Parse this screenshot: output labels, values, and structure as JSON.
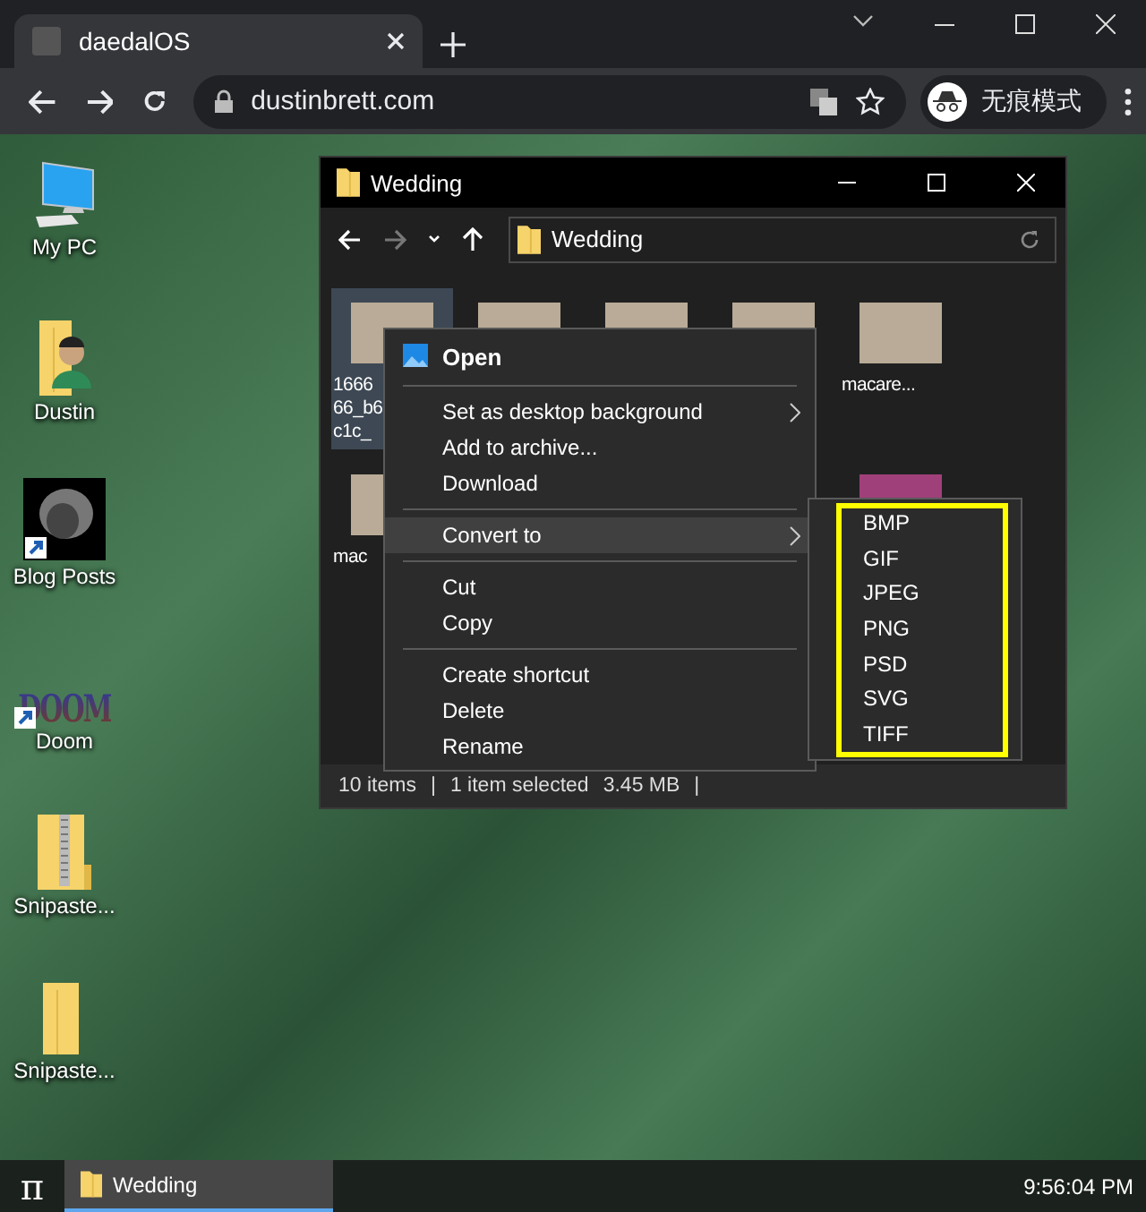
{
  "browser": {
    "tabs": [
      {
        "title": "daedalOS",
        "selected": true
      }
    ],
    "address": "dustinbrett.com",
    "profile": "无痕模式"
  },
  "desktop": {
    "icons": [
      {
        "label": "My PC",
        "kind": "computer"
      },
      {
        "label": "Dustin",
        "kind": "user-folder"
      },
      {
        "label": "Blog Posts",
        "kind": "scan-shortcut"
      },
      {
        "label": "Doom",
        "kind": "logo-shortcut",
        "logo_text": "DOOM"
      },
      {
        "label": "Snipaste...",
        "kind": "zip-folder"
      },
      {
        "label": "Snipaste...",
        "kind": "folder"
      }
    ]
  },
  "explorer": {
    "title": "Wedding",
    "address": "Wedding",
    "forward_disabled": true,
    "file_rows": [
      [
        {
          "label_lines": [
            "1666",
            "66_b6",
            "c1c_"
          ],
          "selected": true
        },
        {
          "selected": false
        },
        {
          "selected": false
        },
        {
          "selected": false
        },
        {
          "label_lines": [
            "macare..."
          ],
          "selected": false
        }
      ],
      [
        {
          "label_lines": [
            "mac"
          ],
          "selected": false
        },
        {
          "selected": false
        }
      ]
    ],
    "status": [
      "10 items",
      "|",
      "1 item selected",
      "3.45 MB",
      "|"
    ]
  },
  "context_menu": {
    "groups": [
      [
        {
          "label": "Open",
          "kind": "default",
          "submenu": false,
          "selected": false
        }
      ],
      [
        {
          "label": "Set as desktop background",
          "kind": "item",
          "submenu": true,
          "selected": false
        },
        {
          "label": "Add to archive...",
          "kind": "item",
          "submenu": false,
          "selected": false
        },
        {
          "label": "Download",
          "kind": "item",
          "submenu": false,
          "selected": false
        }
      ],
      [
        {
          "label": "Convert to",
          "kind": "item",
          "submenu": true,
          "selected": true
        }
      ],
      [
        {
          "label": "Cut",
          "kind": "item",
          "submenu": false,
          "selected": false
        },
        {
          "label": "Copy",
          "kind": "item",
          "submenu": false,
          "selected": false
        }
      ],
      [
        {
          "label": "Create shortcut",
          "kind": "item",
          "submenu": false,
          "selected": false
        },
        {
          "label": "Delete",
          "kind": "item",
          "submenu": false,
          "selected": false
        },
        {
          "label": "Rename",
          "kind": "item",
          "submenu": false,
          "selected": false
        }
      ]
    ]
  },
  "submenu": {
    "items": [
      "BMP",
      "GIF",
      "JPEG",
      "PNG",
      "PSD",
      "SVG",
      "TIFF"
    ],
    "highlighted": true
  },
  "taskbar": {
    "start_label": "π",
    "tasks": [
      {
        "title": "Wedding",
        "selected": true
      }
    ],
    "clock": "9:56:04 PM"
  }
}
